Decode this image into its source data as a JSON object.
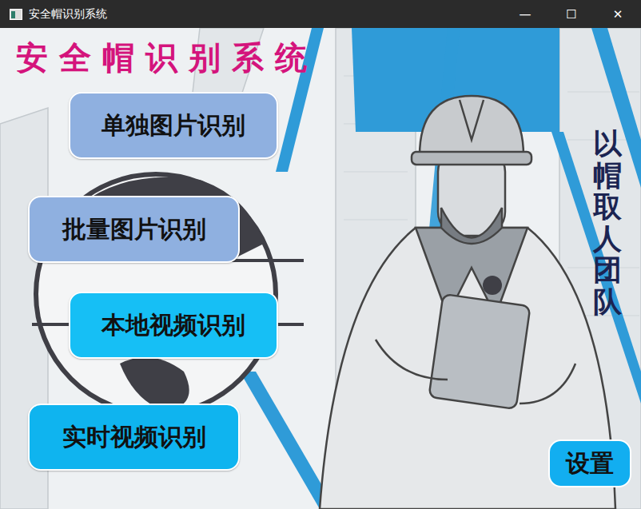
{
  "window": {
    "title": "安全帽识别系统",
    "controls": [
      "—",
      "☐",
      "✕"
    ]
  },
  "heading": "安全帽识别系统",
  "buttons": [
    {
      "label": "单独图片识别",
      "color": "#8fb0e0"
    },
    {
      "label": "批量图片识别",
      "color": "#8fb0e0"
    },
    {
      "label": "本地视频识别",
      "color": "#16bff5"
    },
    {
      "label": "实时视频识别",
      "color": "#0fb4ef"
    }
  ],
  "slogan": "以帽取人团队",
  "settings": "设置"
}
